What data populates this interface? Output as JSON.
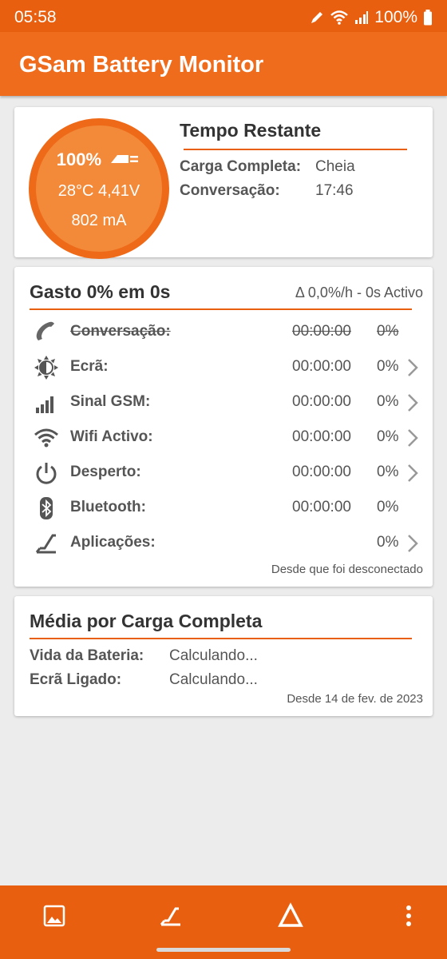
{
  "status_bar": {
    "time": "05:58",
    "battery_pct": "100%"
  },
  "app_bar": {
    "title": "GSam Battery Monitor"
  },
  "battery_card": {
    "percent": "100%",
    "temp_voltage": "28°C  4,41V",
    "current": "802 mA",
    "heading": "Tempo Restante",
    "full_charge_label": "Carga Completa:",
    "full_charge_value": "Cheia",
    "talk_label": "Conversação:",
    "talk_value": "17:46"
  },
  "usage_card": {
    "title": "Gasto 0% em 0s",
    "rate": "Δ 0,0%/h - 0s Activo",
    "rows": [
      {
        "icon": "phone-icon",
        "label": "Conversação:",
        "time": "00:00:00",
        "percent": "0%",
        "chevron": false,
        "struck": true
      },
      {
        "icon": "brightness-icon",
        "label": "Ecrã:",
        "time": "00:00:00",
        "percent": "0%",
        "chevron": true
      },
      {
        "icon": "signal-bars-icon",
        "label": "Sinal GSM:",
        "time": "00:00:00",
        "percent": "0%",
        "chevron": true
      },
      {
        "icon": "wifi-icon",
        "label": "Wifi Activo:",
        "time": "00:00:00",
        "percent": "0%",
        "chevron": true
      },
      {
        "icon": "power-icon",
        "label": "Desperto:",
        "time": "00:00:00",
        "percent": "0%",
        "chevron": true
      },
      {
        "icon": "bluetooth-icon",
        "label": "Bluetooth:",
        "time": "00:00:00",
        "percent": "0%",
        "chevron": false
      },
      {
        "icon": "apps-icon",
        "label": "Aplicações:",
        "time": "",
        "percent": "0%",
        "chevron": true
      }
    ],
    "footer": "Desde que foi desconectado"
  },
  "average_card": {
    "title": "Média por Carga Completa",
    "battery_life_label": "Vida da Bateria:",
    "battery_life_value": "Calculando...",
    "screen_on_label": "Ecrã Ligado:",
    "screen_on_value": "Calculando...",
    "footer": "Desde 14 de fev. de 2023"
  },
  "bottom_bar": {
    "buttons": [
      "image-icon",
      "apps-icon",
      "delta-icon",
      "more-vert-icon"
    ]
  },
  "colors": {
    "accent": "#e8600f",
    "card": "#ffffff",
    "background": "#ececec"
  }
}
